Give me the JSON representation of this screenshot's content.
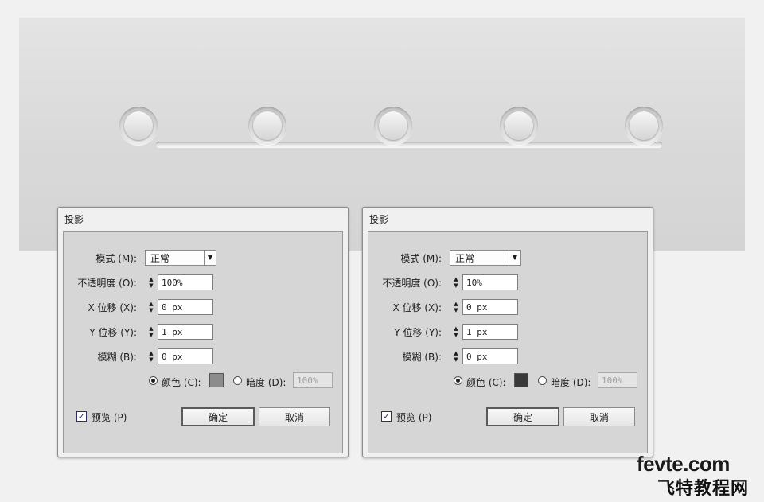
{
  "dialogs": [
    {
      "title": "投影",
      "mode_label": "模式 (M):",
      "mode_value": "正常",
      "opacity_label": "不透明度 (O):",
      "opacity_value": "100%",
      "x_label": "X 位移 (X):",
      "x_value": "0 px",
      "y_label": "Y 位移 (Y):",
      "y_value": "1 px",
      "blur_label": "模糊 (B):",
      "blur_value": "0 px",
      "color_label": "颜色 (C):",
      "color_swatch": "#8c8c8c",
      "dark_label": "暗度 (D):",
      "dark_value": "100%",
      "preview_label": "预览 (P)",
      "ok_label": "确定",
      "cancel_label": "取消"
    },
    {
      "title": "投影",
      "mode_label": "模式 (M):",
      "mode_value": "正常",
      "opacity_label": "不透明度 (O):",
      "opacity_value": "10%",
      "x_label": "X 位移 (X):",
      "x_value": "0 px",
      "y_label": "Y 位移 (Y):",
      "y_value": "1 px",
      "blur_label": "模糊 (B):",
      "blur_value": "0 px",
      "color_label": "颜色 (C):",
      "color_swatch": "#3a3a3a",
      "dark_label": "暗度 (D):",
      "dark_value": "100%",
      "preview_label": "预览 (P)",
      "ok_label": "确定",
      "cancel_label": "取消"
    }
  ],
  "watermark": {
    "line1": "fevte.com",
    "line2": "飞特教程网"
  }
}
